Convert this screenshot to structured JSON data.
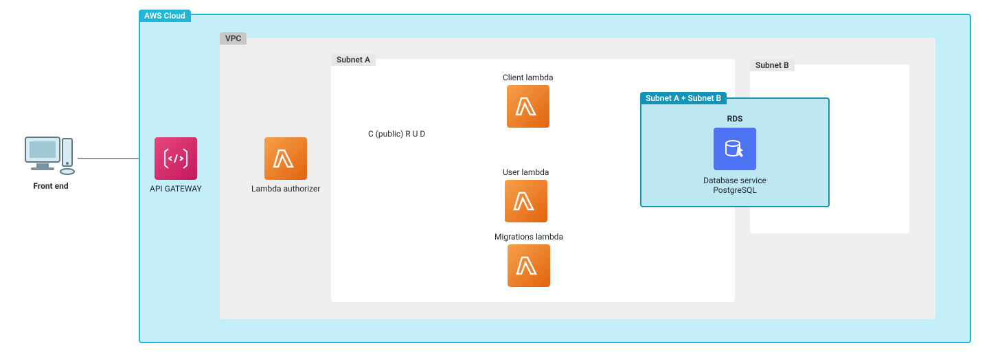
{
  "labels": {
    "frontend": "Front end",
    "api_gateway": "API GATEWAY",
    "lambda_auth": "Lambda authorizer",
    "client_lambda": "Client lambda",
    "user_lambda": "User lambda",
    "migrations_lambda": "Migrations lambda",
    "crud": "C (public) R U D",
    "rds_title": "RDS",
    "rds_line1": "Database service",
    "rds_line2": "PostgreSQL"
  },
  "containers": {
    "aws_cloud": "AWS Cloud",
    "vpc": "VPC",
    "subnet_a": "Subnet A",
    "subnet_b": "Subnet B",
    "subnet_ab": "Subnet A + Subnet B"
  },
  "colors": {
    "cloud_border": "#1fb6d9",
    "cloud_fill": "#c4eff8",
    "cloud_tag_bg": "#1fb6d9",
    "vpc_fill": "#efefef",
    "vpc_tag": "#c8c8c8",
    "subnet_fill": "#ffffff",
    "subnet_tag": "#e8e8e8",
    "subnet_ab_fill": "#bde8f1",
    "subnet_ab_border": "#1194b5",
    "lambda": "#ec7211",
    "api_gw": "#d6336c",
    "rds": "#4d72f3"
  }
}
